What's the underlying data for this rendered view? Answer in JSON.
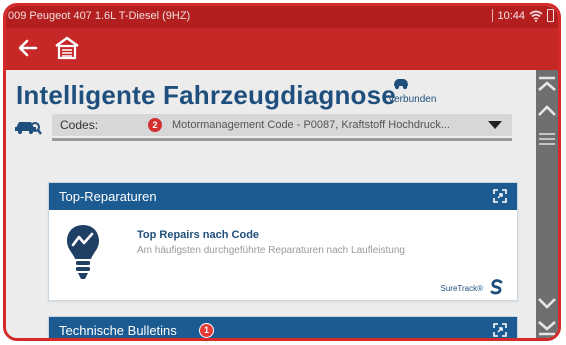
{
  "status_bar": {
    "title": "009 Peugeot 407 1.6L T-Diesel (9HZ)",
    "time": "10:44"
  },
  "nav": {
    "back_icon": "back-arrow-icon",
    "home_icon": "home-garage-icon"
  },
  "header": {
    "title": "Intelligente Fahrzeugdiagnose",
    "connection_icon": "vehicle-connected-icon",
    "connection_label": "Verbunden"
  },
  "codes": {
    "label": "Codes:",
    "count": "2",
    "value": "Motormanagement Code - P0087, Kraftstoff Hochdruck..."
  },
  "cards": {
    "top_repairs": {
      "title": "Top-Reparaturen",
      "item_title": "Top Repairs nach Code",
      "item_desc": "Am häufigsten durchgeführte Reparaturen nach Laufleistung",
      "brand": "SureTrack®"
    },
    "bulletins": {
      "title": "Technische Bulletins",
      "count": "1"
    }
  },
  "colors": {
    "accent_red": "#c62828",
    "header_blue": "#1c5b91",
    "title_blue": "#1f4f7d",
    "badge_red": "#d32f2f"
  }
}
